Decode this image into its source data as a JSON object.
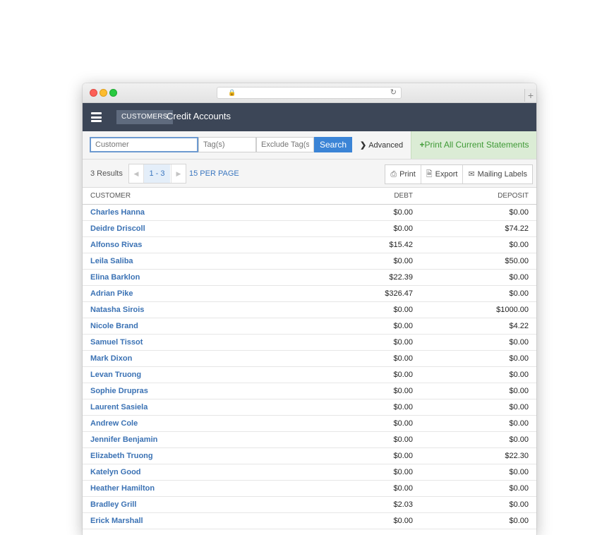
{
  "header": {
    "breadcrumb": "CUSTOMERS",
    "title": "Credit Accounts"
  },
  "search": {
    "customer_placeholder": "Customer",
    "tags_placeholder": "Tag(s)",
    "exclude_placeholder": "Exclude Tag(s)",
    "search_label": "Search",
    "advanced_label": "Advanced",
    "print_all_label": "Print All Current Statements"
  },
  "toolbar": {
    "results": "3 Results",
    "page": "1 - 3",
    "per_page": "15 PER PAGE",
    "print_label": "Print",
    "export_label": "Export",
    "mailing_label": "Mailing Labels"
  },
  "table": {
    "columns": [
      "CUSTOMER",
      "DEBT",
      "DEPOSIT"
    ],
    "rows": [
      [
        "Charles Hanna",
        "$0.00",
        "$0.00"
      ],
      [
        "Deidre Driscoll",
        "$0.00",
        "$74.22"
      ],
      [
        "Alfonso Rivas",
        "$15.42",
        "$0.00"
      ],
      [
        "Leila Saliba",
        "$0.00",
        "$50.00"
      ],
      [
        "Elina Barklon",
        "$22.39",
        "$0.00"
      ],
      [
        "Adrian Pike",
        "$326.47",
        "$0.00"
      ],
      [
        "Natasha Sirois",
        "$0.00",
        "$1000.00"
      ],
      [
        "Nicole Brand",
        "$0.00",
        "$4.22"
      ],
      [
        "Samuel Tissot",
        "$0.00",
        "$0.00"
      ],
      [
        "Mark Dixon",
        "$0.00",
        "$0.00"
      ],
      [
        "Levan Truong",
        "$0.00",
        "$0.00"
      ],
      [
        "Sophie Drupras",
        "$0.00",
        "$0.00"
      ],
      [
        "Laurent Sasiela",
        "$0.00",
        "$0.00"
      ],
      [
        "Andrew Cole",
        "$0.00",
        "$0.00"
      ],
      [
        "Jennifer Benjamin",
        "$0.00",
        "$0.00"
      ],
      [
        "Elizabeth Truong",
        "$0.00",
        "$22.30"
      ],
      [
        "Katelyn Good",
        "$0.00",
        "$0.00"
      ],
      [
        "Heather Hamilton",
        "$0.00",
        "$0.00"
      ],
      [
        "Bradley Grill",
        "$2.03",
        "$0.00"
      ],
      [
        "Erick Marshall",
        "$0.00",
        "$0.00"
      ]
    ]
  },
  "icons": {
    "lock": "lock-icon",
    "reload": "reload-icon",
    "plus": "plus-icon",
    "menu": "hamburger-icon",
    "printer": "printer-icon",
    "export": "export-file-icon",
    "envelope": "envelope-icon"
  }
}
